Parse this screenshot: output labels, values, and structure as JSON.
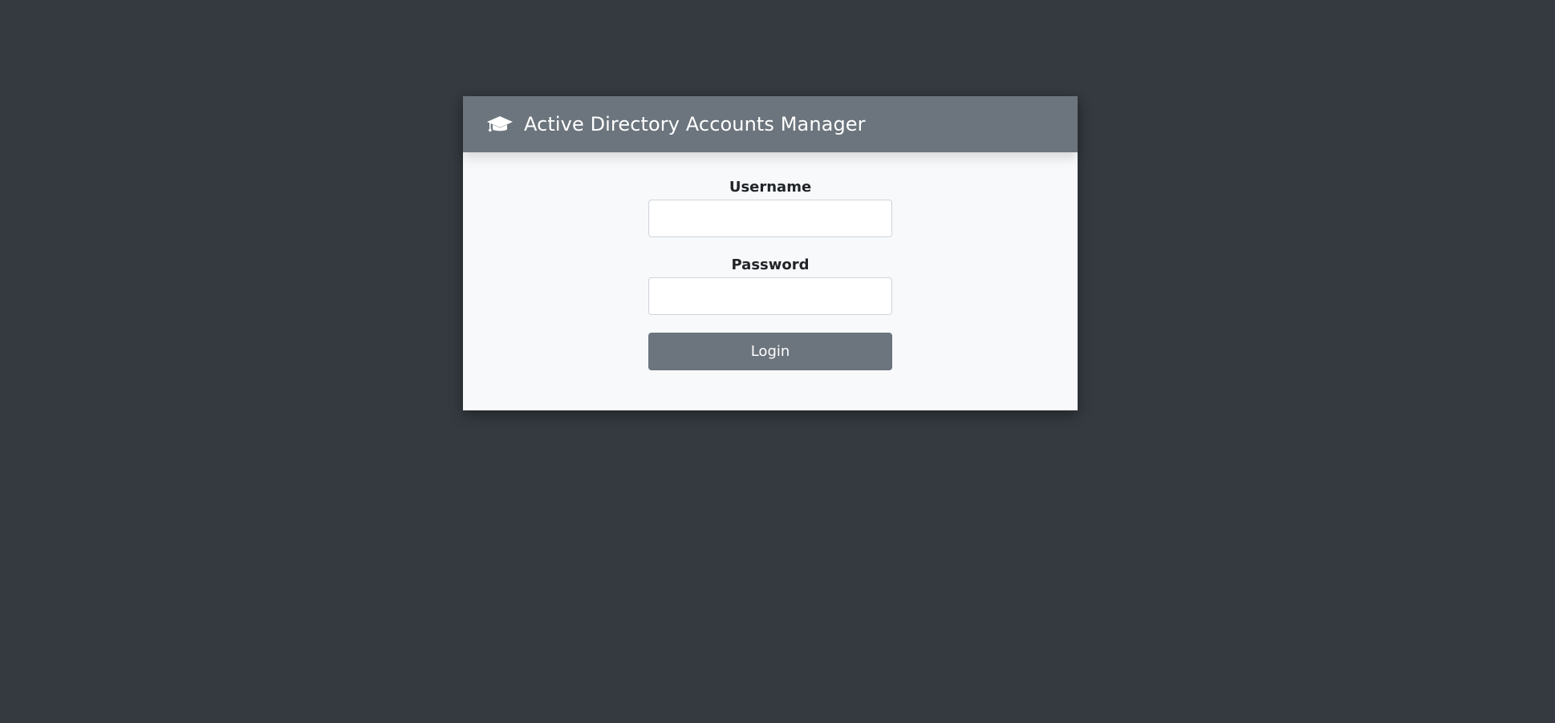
{
  "header": {
    "icon": "graduation-cap-icon",
    "title": "Active Directory Accounts Manager"
  },
  "form": {
    "username_label": "Username",
    "username_value": "",
    "password_label": "Password",
    "password_value": "",
    "login_label": "Login"
  },
  "colors": {
    "page_background": "#343a40",
    "header_background": "#6c757d",
    "card_background": "#f8f9fa",
    "button_background": "#6c757d"
  }
}
